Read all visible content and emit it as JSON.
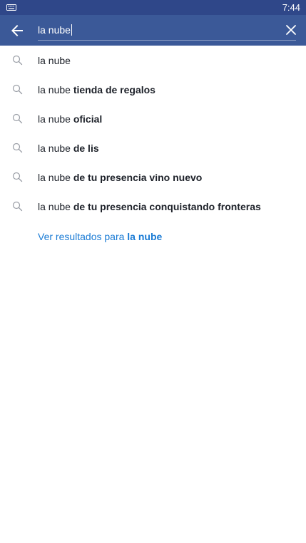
{
  "status_bar": {
    "time": "7:44",
    "keyboard_icon": "keyboard-icon"
  },
  "search": {
    "query": "la nube",
    "back_icon": "arrow-left-icon",
    "clear_icon": "close-icon"
  },
  "suggestions": [
    {
      "prefix": "la nube",
      "completion": ""
    },
    {
      "prefix": "la nube",
      "completion": "tienda de regalos"
    },
    {
      "prefix": "la nube",
      "completion": "oficial"
    },
    {
      "prefix": "la nube",
      "completion": "de lis"
    },
    {
      "prefix": "la nube",
      "completion": "de tu presencia vino nuevo"
    },
    {
      "prefix": "la nube",
      "completion": "de tu presencia conquistando fronteras"
    }
  ],
  "see_results": {
    "label": "Ver resultados para",
    "query": "la nube"
  },
  "colors": {
    "header_bg": "#3b5998",
    "status_bg": "#2f4789",
    "link": "#1a7bd5"
  }
}
